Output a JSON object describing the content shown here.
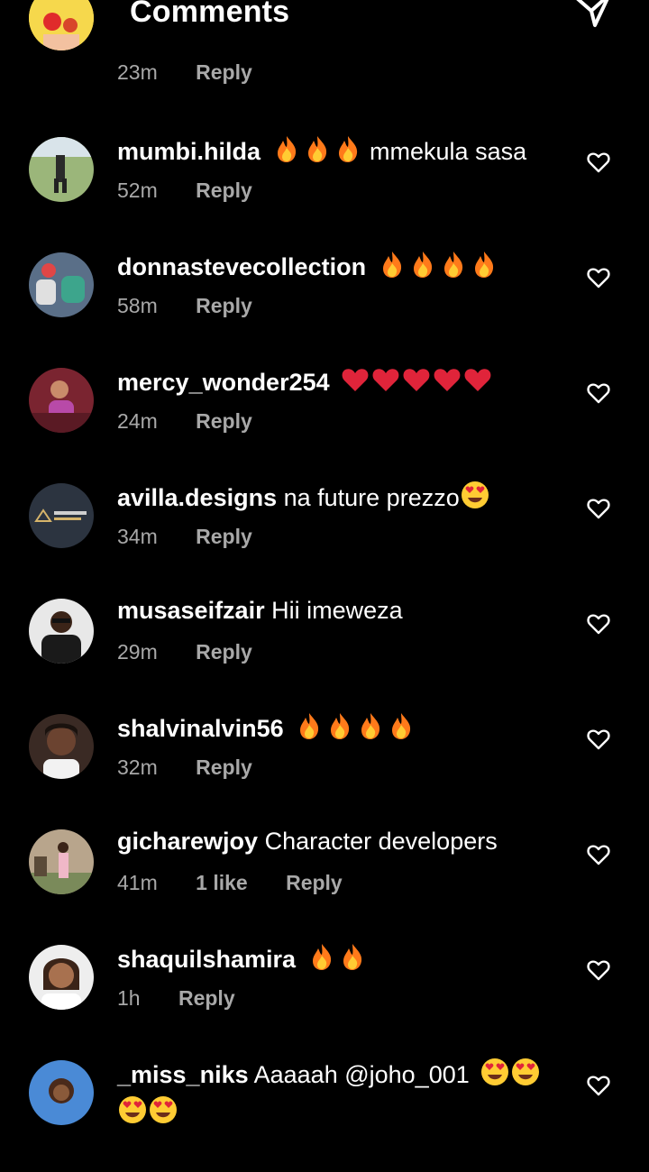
{
  "header": {
    "title": "Comments",
    "back_icon": "arrow-left-icon",
    "send_icon": "send-icon"
  },
  "colors": {
    "background": "#000000",
    "text": "#ffffff",
    "meta_text": "#a8a8a8",
    "fire": "#ff7a1a",
    "heart_red": "#e0243a"
  },
  "comments": [
    {
      "username": "",
      "text": "",
      "time": "23m",
      "likes": "",
      "reply": "Reply",
      "emoji": ""
    },
    {
      "username": "mumbi.hilda",
      "text": "mmekula sasa",
      "time": "52m",
      "likes": "",
      "reply": "Reply",
      "emoji": "fire-emoji x3"
    },
    {
      "username": "donnastevecollection",
      "text": "",
      "time": "58m",
      "likes": "",
      "reply": "Reply",
      "emoji": "fire-emoji x4"
    },
    {
      "username": "mercy_wonder254",
      "text": "",
      "time": "24m",
      "likes": "",
      "reply": "Reply",
      "emoji": "red-heart-emoji x5"
    },
    {
      "username": "avilla.designs",
      "text": "na future prezzo",
      "time": "34m",
      "likes": "",
      "reply": "Reply",
      "emoji": "heart-eyes-emoji x1"
    },
    {
      "username": "musaseifzair",
      "text": "Hii imeweza",
      "time": "29m",
      "likes": "",
      "reply": "Reply",
      "emoji": ""
    },
    {
      "username": "shalvinalvin56",
      "text": "",
      "time": "32m",
      "likes": "",
      "reply": "Reply",
      "emoji": "fire-emoji x4"
    },
    {
      "username": "gicharewjoy",
      "text": "Character developers",
      "time": "41m",
      "likes": "1 like",
      "reply": "Reply",
      "emoji": ""
    },
    {
      "username": "shaquilshamira",
      "text": "",
      "time": "1h",
      "likes": "",
      "reply": "Reply",
      "emoji": "fire-emoji x2"
    },
    {
      "username": "_miss_niks",
      "text": "Aaaaah @joho_001",
      "time": "",
      "likes": "",
      "reply": "",
      "emoji": "heart-eyes-emoji x4"
    }
  ]
}
